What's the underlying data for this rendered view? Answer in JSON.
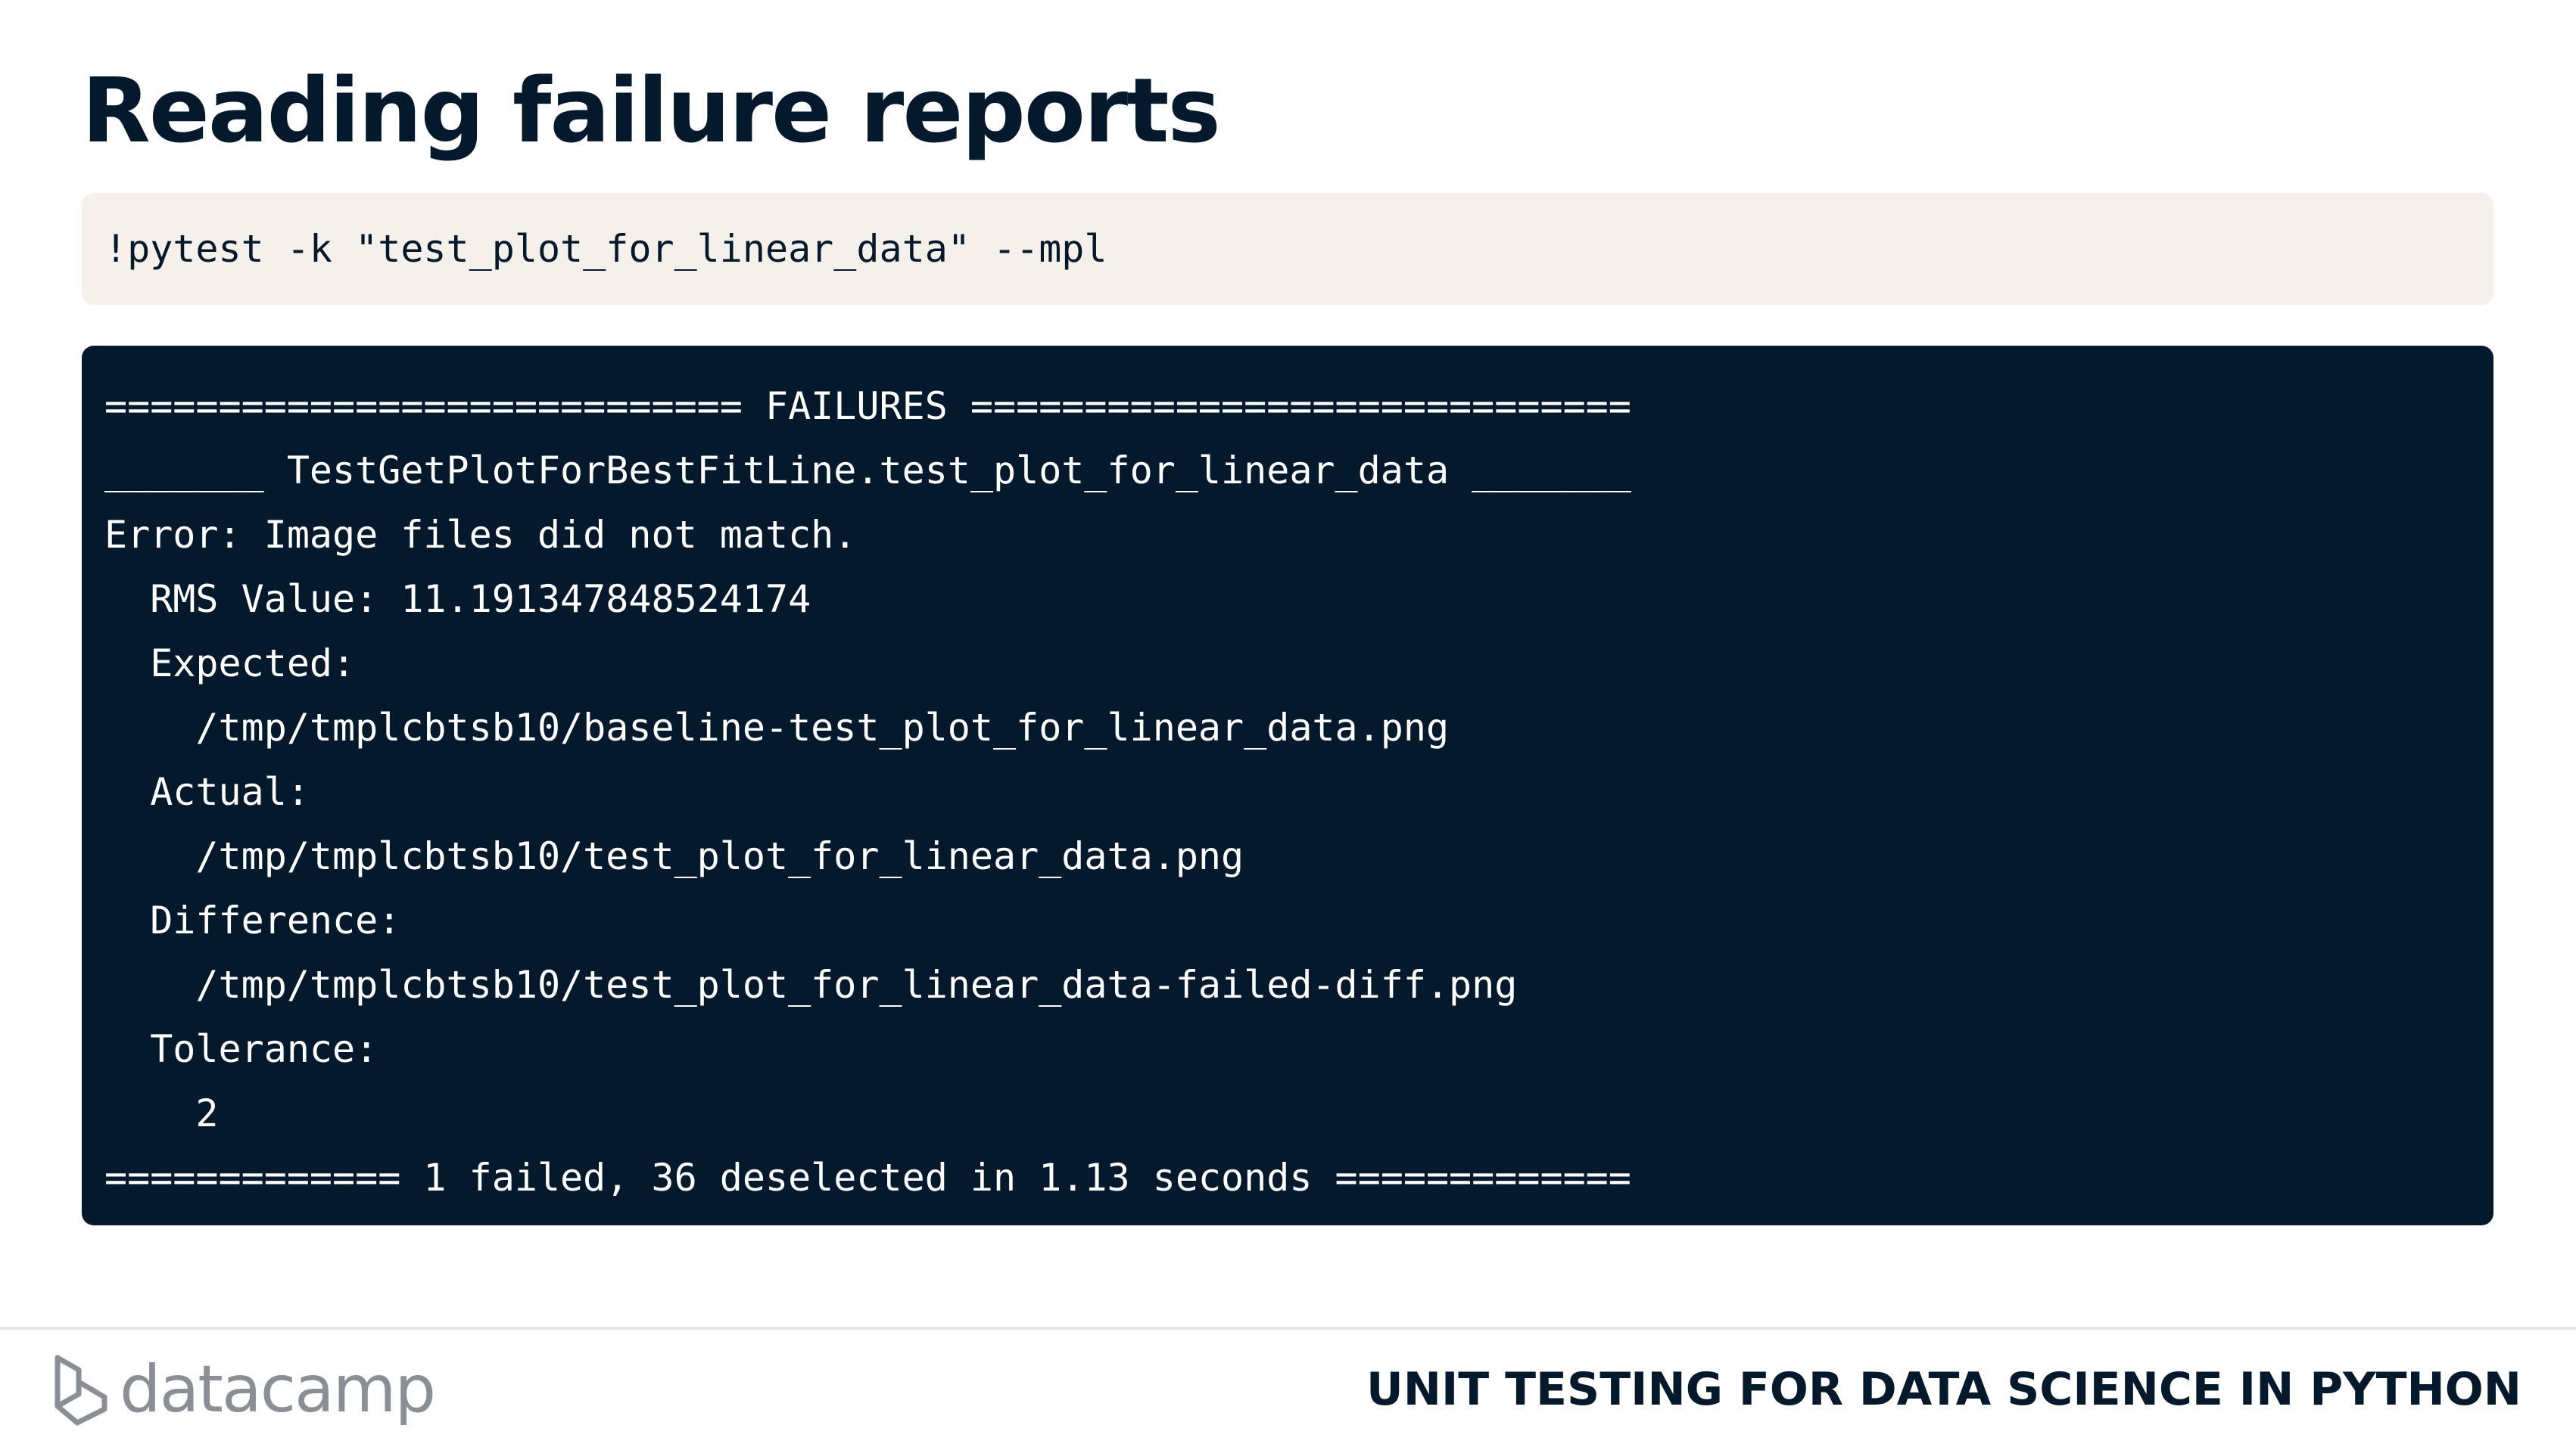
{
  "slide": {
    "title": "Reading failure reports",
    "command": "!pytest -k \"test_plot_for_linear_data\" --mpl",
    "output_lines": [
      "============================ FAILURES =============================",
      "_______ TestGetPlotForBestFitLine.test_plot_for_linear_data _______",
      "Error: Image files did not match.",
      "  RMS Value: 11.191347848524174",
      "  Expected:",
      "    /tmp/tmplcbtsb10/baseline-test_plot_for_linear_data.png",
      "  Actual:",
      "    /tmp/tmplcbtsb10/test_plot_for_linear_data.png",
      "  Difference:",
      "    /tmp/tmplcbtsb10/test_plot_for_linear_data-failed-diff.png",
      "  Tolerance:",
      "    2",
      "============= 1 failed, 36 deselected in 1.13 seconds ============="
    ]
  },
  "footer": {
    "logo_text": "datacamp",
    "course_title": "UNIT TESTING FOR DATA SCIENCE IN PYTHON"
  },
  "colors": {
    "navy": "#05192d",
    "command_bg": "#f5f1ea",
    "logo_gray": "#8a8f96"
  }
}
